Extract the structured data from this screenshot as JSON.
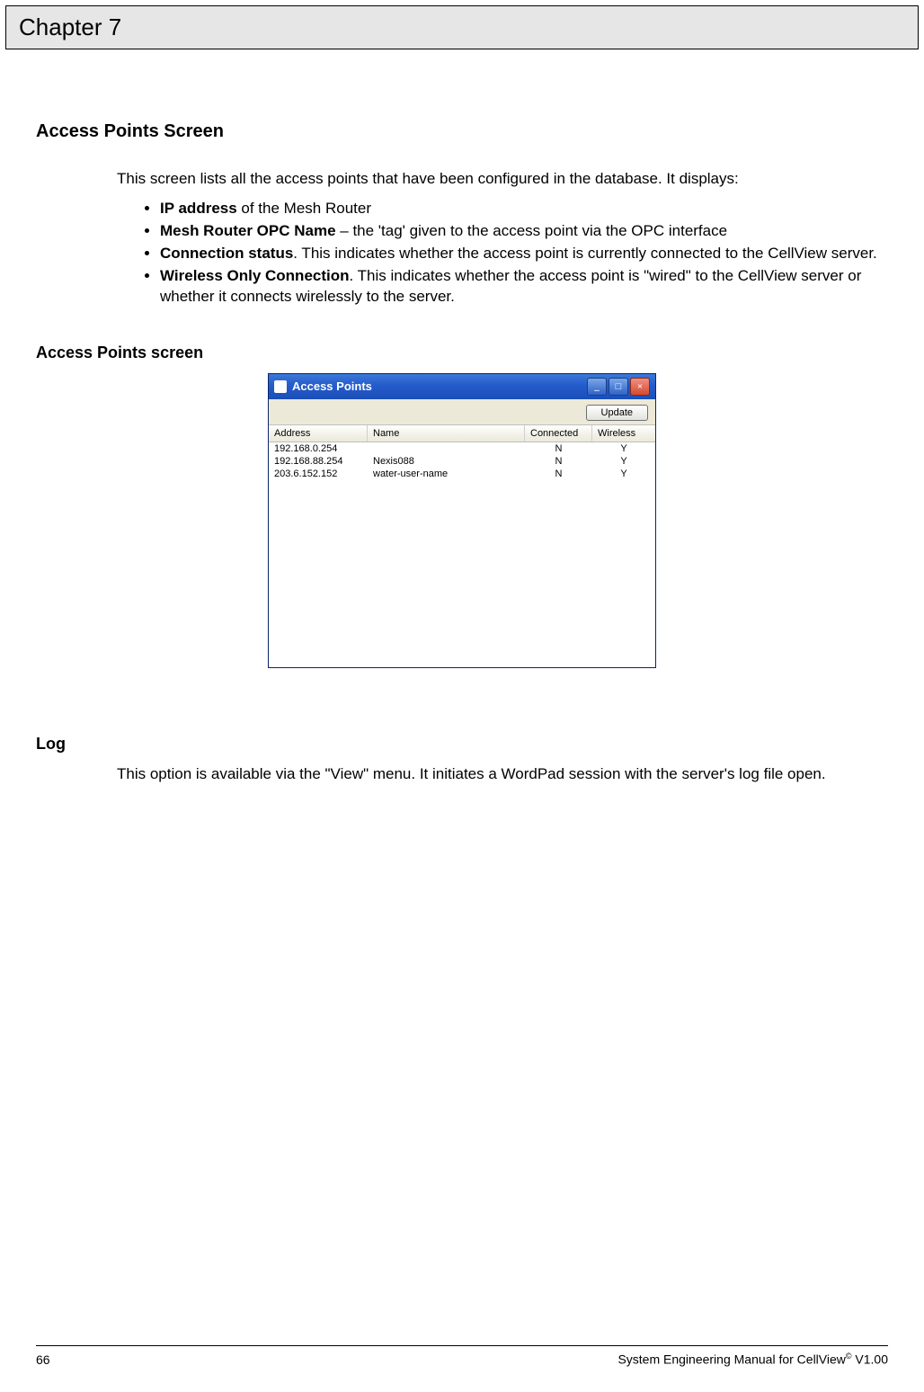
{
  "chapter_label": "Chapter 7",
  "section1": {
    "title": "Access Points Screen",
    "intro": "This screen lists all the access points that have been configured in the database.  It displays:",
    "bullets": [
      {
        "bold": "IP address",
        "rest": " of the Mesh Router"
      },
      {
        "bold": "Mesh Router OPC Name",
        "rest": " – the 'tag' given to the access point via the OPC interface"
      },
      {
        "bold": "Connection status",
        "rest": ".  This indicates whether the access point is currently connected to the CellView server."
      },
      {
        "bold": "Wireless Only Connection",
        "rest": ".  This indicates whether the access point is \"wired\" to the CellView server or whether it connects wirelessly to the server."
      }
    ]
  },
  "caption1": "Access Points screen",
  "window": {
    "title": "Access Points",
    "btn_min": "_",
    "btn_max": "□",
    "btn_close": "×",
    "update_label": "Update",
    "headers": {
      "address": "Address",
      "name": "Name",
      "connected": "Connected",
      "wireless": "Wireless"
    },
    "rows": [
      {
        "address": "192.168.0.254",
        "name": "",
        "connected": "N",
        "wireless": "Y"
      },
      {
        "address": "192.168.88.254",
        "name": "Nexis088",
        "connected": "N",
        "wireless": "Y"
      },
      {
        "address": "203.6.152.152",
        "name": "water-user-name",
        "connected": "N",
        "wireless": "Y"
      }
    ]
  },
  "section2": {
    "title": "Log",
    "text": "This option is available via the \"View\" menu.  It initiates a WordPad session with the server's log file open."
  },
  "footer": {
    "page": "66",
    "right_a": "System Engineering Manual for CellView",
    "right_b": " V1.00",
    "reg": "©"
  }
}
